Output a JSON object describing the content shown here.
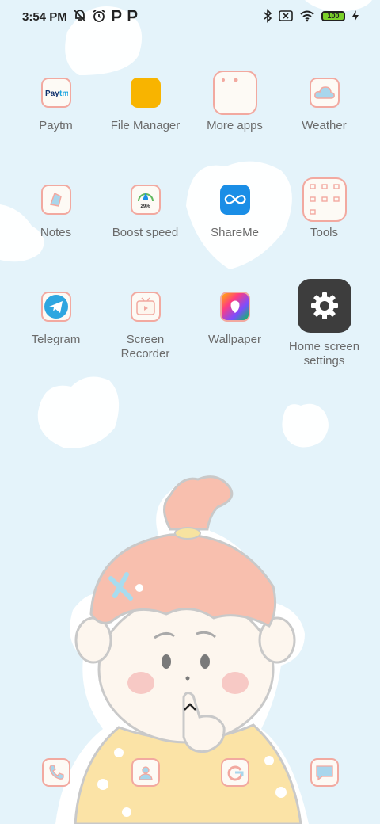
{
  "status_bar": {
    "time": "3:54 PM",
    "battery": "100",
    "left_icons": [
      "notification-off-icon",
      "alarm-icon",
      "parking-icon",
      "parking-icon"
    ],
    "right_icons": [
      "bluetooth-icon",
      "sim-off-icon",
      "wifi-icon",
      "battery-icon",
      "charging-icon"
    ]
  },
  "apps": [
    {
      "label": "Paytm",
      "icon": "paytm-icon"
    },
    {
      "label": "File Manager",
      "icon": "folder-icon"
    },
    {
      "label": "More apps",
      "icon": "folder-grid-icon"
    },
    {
      "label": "Weather",
      "icon": "cloud-icon"
    },
    {
      "label": "Notes",
      "icon": "notes-icon"
    },
    {
      "label": "Boost speed",
      "icon": "rocket-icon",
      "badge": "29%"
    },
    {
      "label": "ShareMe",
      "icon": "infinity-icon"
    },
    {
      "label": "Tools",
      "icon": "tools-grid-icon"
    },
    {
      "label": "Telegram",
      "icon": "telegram-icon"
    },
    {
      "label": "Screen Recorder",
      "icon": "recorder-icon"
    },
    {
      "label": "Wallpaper",
      "icon": "wallpaper-icon"
    },
    {
      "label": "Home screen settings",
      "icon": "gear-icon"
    }
  ],
  "dock": [
    {
      "icon": "phone-icon"
    },
    {
      "icon": "contacts-icon"
    },
    {
      "icon": "browser-icon"
    },
    {
      "icon": "messages-icon"
    }
  ],
  "colors": {
    "background": "#e4f3fa",
    "icon_border": "#f2a9a0",
    "label": "#6b6b6b",
    "settings_tile": "#3d3d3d",
    "file_manager": "#f8b400",
    "shareme": "#1a8ee6",
    "telegram": "#2ea6e0"
  }
}
